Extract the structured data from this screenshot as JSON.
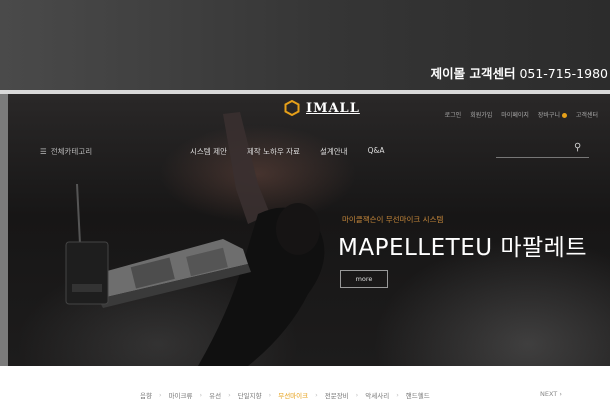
{
  "header": {
    "support_label": "제이몰 고객센터",
    "support_phone": "051-715-1980"
  },
  "banner": {
    "logo_text": "IMALL",
    "util_links": [
      "로그인",
      "회원가입",
      "마이페이지",
      "장바구니",
      "고객센터"
    ],
    "all_categories": "전체카테고리",
    "nav": [
      "시스템 제안",
      "제작 노하우 자료",
      "설계안내",
      "Q&A"
    ],
    "subtitle": "마이클잭슨이 무선마이크 시스템",
    "title": "MAPELLETEU 마팔레트",
    "more_button": "more"
  },
  "breadcrumb": {
    "items": [
      "음향",
      "마이크류",
      "유선",
      "단일지향",
      "무선마이크",
      "전문장비",
      "악세사리",
      "핸드헬드"
    ],
    "active_index": 4,
    "next_label": "NEXT"
  },
  "colors": {
    "accent": "#e6a019",
    "dark": "#171616"
  }
}
